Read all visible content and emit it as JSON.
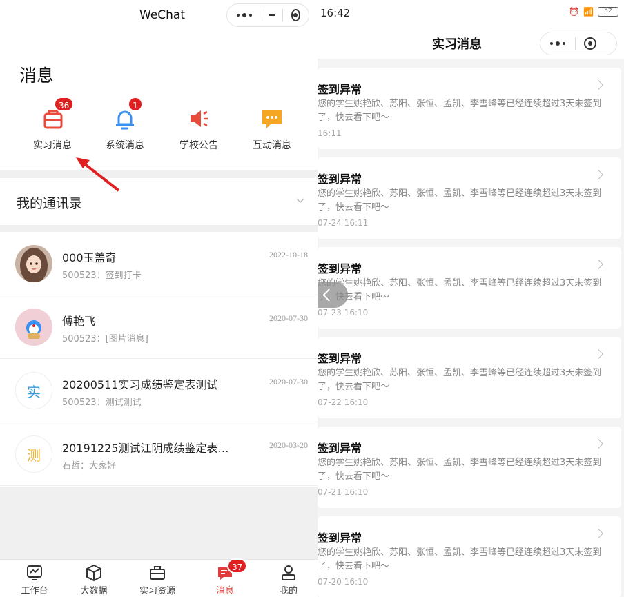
{
  "left": {
    "wechat_title": "WeChat",
    "heading": "消息",
    "quick_items": [
      {
        "label": "实习消息",
        "icon": "briefcase-icon",
        "badge": "36",
        "color": "#e84a3c"
      },
      {
        "label": "系统消息",
        "icon": "bell-icon",
        "badge": "1",
        "color": "#3a8ff0"
      },
      {
        "label": "学校公告",
        "icon": "megaphone-icon",
        "badge": "",
        "color": "#e84a3c"
      },
      {
        "label": "互动消息",
        "icon": "chat-bubble-icon",
        "badge": "",
        "color": "#f5a623"
      }
    ],
    "contacts_header": "我的通讯录",
    "conversations": [
      {
        "name": "000玉盖奇",
        "sub": "500523：签到打卡",
        "time": "2022-10-18",
        "avatar_char": "",
        "avatar_kind": "photo-girl"
      },
      {
        "name": "傅艳飞",
        "sub": "500523：[图片消息]",
        "time": "2020-07-30",
        "avatar_char": "",
        "avatar_kind": "photo-doraemon"
      },
      {
        "name": "20200511实习成绩鉴定表测试",
        "sub": "500523：测试测试",
        "time": "2020-07-30",
        "avatar_char": "实",
        "avatar_kind": "letter-blue"
      },
      {
        "name": "20191225测试江阴成绩鉴定表…",
        "sub": "石哲：大家好",
        "time": "2020-03-20",
        "avatar_char": "测",
        "avatar_kind": "letter-yellow"
      }
    ],
    "tabbar": [
      {
        "label": "工作台",
        "icon": "dashboard-icon",
        "badge": ""
      },
      {
        "label": "大数据",
        "icon": "cube-icon",
        "badge": ""
      },
      {
        "label": "实习资源",
        "icon": "briefcase-icon",
        "badge": ""
      },
      {
        "label": "消息",
        "icon": "message-icon",
        "badge": "37",
        "active": true
      },
      {
        "label": "我的",
        "icon": "person-icon",
        "badge": ""
      }
    ]
  },
  "right": {
    "status_time": "16:42",
    "status_battery": "52",
    "nav_title": "实习消息",
    "cards": [
      {
        "title": "签到异常",
        "body": "您的学生姚艳欣、苏阳、张恒、孟凯、李雪峰等已经连续超过3天未签到了，快去看下吧～",
        "date": "16:11"
      },
      {
        "title": "签到异常",
        "body": "您的学生姚艳欣、苏阳、张恒、孟凯、李雪峰等已经连续超过3天未签到了，快去看下吧～",
        "date": "07-24 16:11"
      },
      {
        "title": "签到异常",
        "body": "您的学生姚艳欣、苏阳、张恒、孟凯、李雪峰等已经连续超过3天未签到了，快去看下吧～",
        "date": "07-23 16:10"
      },
      {
        "title": "签到异常",
        "body": "您的学生姚艳欣、苏阳、张恒、孟凯、李雪峰等已经连续超过3天未签到了，快去看下吧～",
        "date": "07-22 16:10"
      },
      {
        "title": "签到异常",
        "body": "您的学生姚艳欣、苏阳、张恒、孟凯、李雪峰等已经连续超过3天未签到了，快去看下吧～",
        "date": "07-21 16:10"
      },
      {
        "title": "签到异常",
        "body": "您的学生姚艳欣、苏阳、张恒、孟凯、李雪峰等已经连续超过3天未签到了，快去看下吧～",
        "date": "07-20 16:10"
      }
    ]
  }
}
